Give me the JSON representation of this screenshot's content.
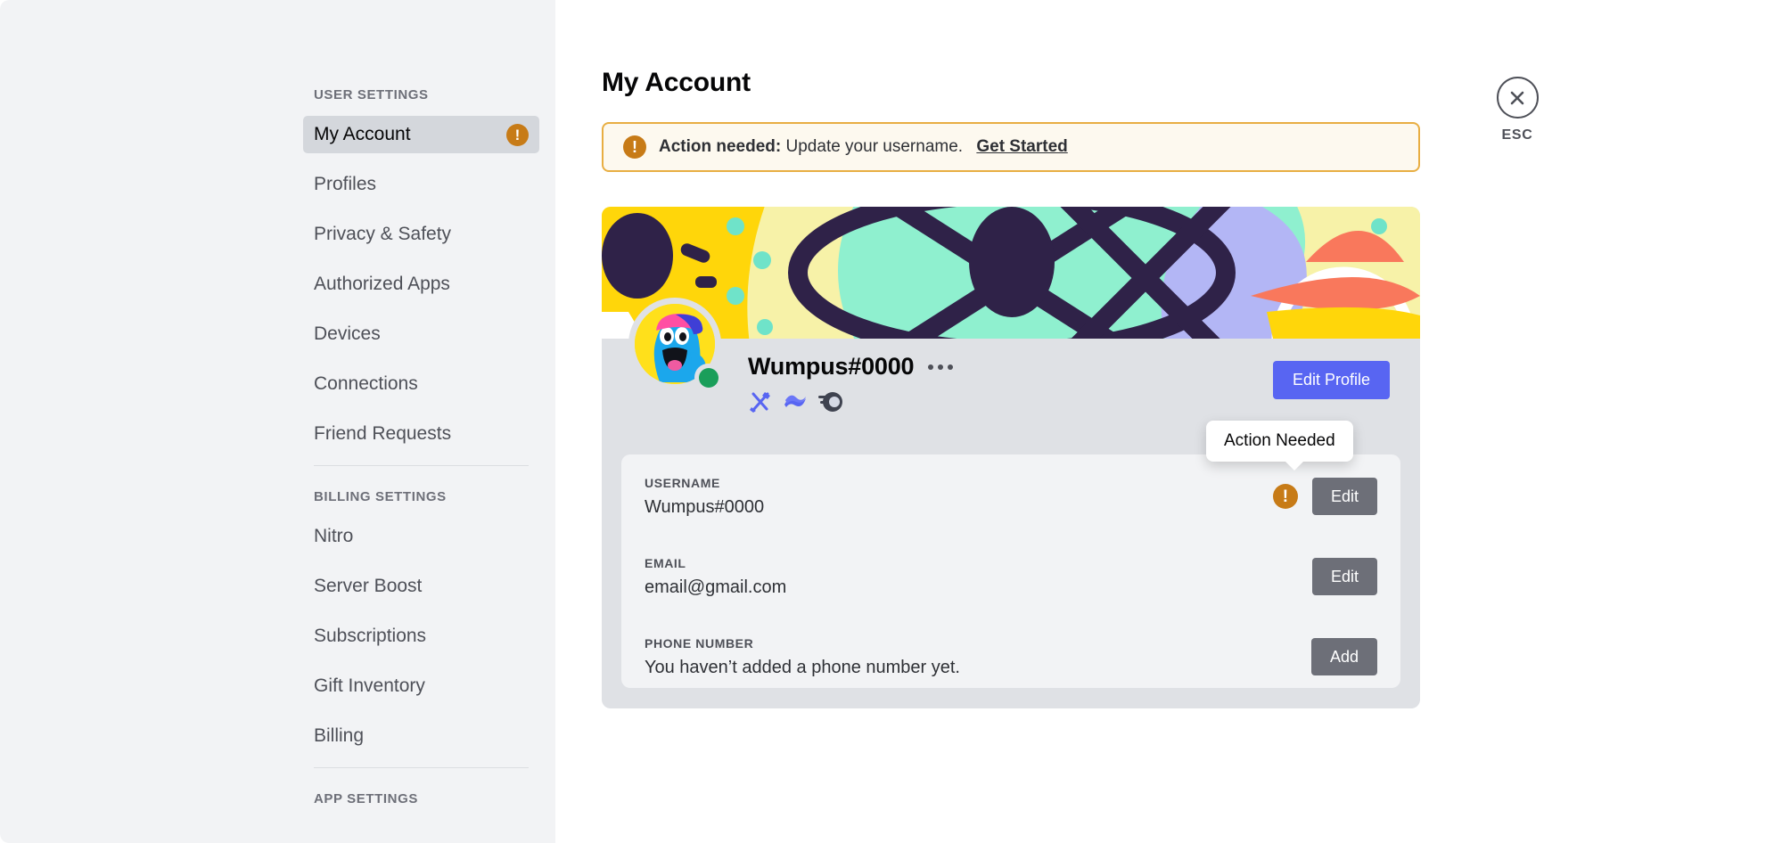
{
  "window": {
    "close_icon": "close-x-icon",
    "esc_label": "ESC"
  },
  "sidebar": {
    "sections": [
      {
        "header": "USER SETTINGS",
        "items": [
          {
            "label": "My Account",
            "active": true,
            "badge": "!"
          },
          {
            "label": "Profiles",
            "active": false
          },
          {
            "label": "Privacy & Safety",
            "active": false
          },
          {
            "label": "Authorized Apps",
            "active": false
          },
          {
            "label": "Devices",
            "active": false
          },
          {
            "label": "Connections",
            "active": false
          },
          {
            "label": "Friend Requests",
            "active": false
          }
        ]
      },
      {
        "header": "BILLING SETTINGS",
        "items": [
          {
            "label": "Nitro",
            "active": false
          },
          {
            "label": "Server Boost",
            "active": false
          },
          {
            "label": "Subscriptions",
            "active": false
          },
          {
            "label": "Gift Inventory",
            "active": false
          },
          {
            "label": "Billing",
            "active": false
          }
        ]
      },
      {
        "header": "APP SETTINGS",
        "items": []
      }
    ]
  },
  "main": {
    "title": "My Account",
    "alert": {
      "icon": "warning-exclamation-icon",
      "strong": "Action needed:",
      "message": "Update your username.",
      "link": "Get Started"
    },
    "profile": {
      "avatar_icon": "wumpus-avatar-icon",
      "status": "online",
      "username": "Wumpus#0000",
      "more_icon": "more-options-icon",
      "badges": [
        {
          "name": "hypesquad-events-badge"
        },
        {
          "name": "nitro-wave-badge"
        },
        {
          "name": "comet-badge"
        }
      ],
      "edit_profile_label": "Edit Profile"
    },
    "fields": [
      {
        "label": "USERNAME",
        "value": "Wumpus#0000",
        "action": "Edit",
        "warning": "!",
        "warning_tooltip": "Action Needed"
      },
      {
        "label": "EMAIL",
        "value": "email@gmail.com",
        "action": "Edit",
        "warning": null
      },
      {
        "label": "PHONE NUMBER",
        "value": "You haven’t added a phone number yet.",
        "action": "Add",
        "warning": null
      }
    ],
    "tooltip": "Action Needed"
  },
  "colors": {
    "accent": "#5865f2",
    "warning": "#c77b17",
    "online": "#1a9e5a",
    "sidebar_bg": "#f2f3f5",
    "card_bg": "#dfe1e5",
    "gray_button": "#6d6f78"
  }
}
